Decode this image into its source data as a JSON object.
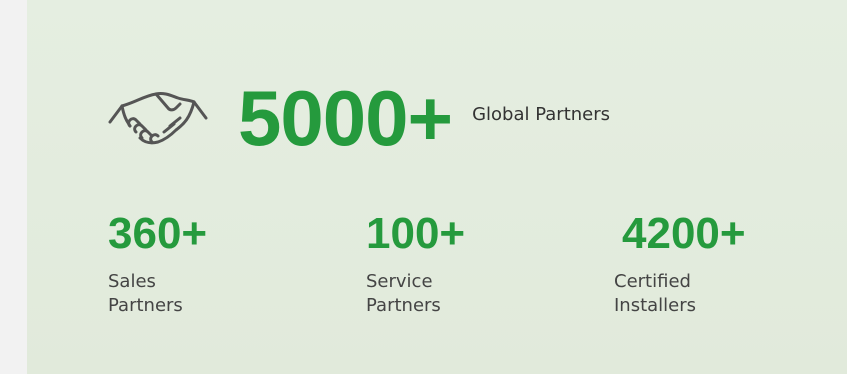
{
  "hero": {
    "value": "5000+",
    "label": "Global Partners",
    "icon": "handshake-icon"
  },
  "stats": [
    {
      "value": "360+",
      "label": "Sales\nPartners"
    },
    {
      "value": "100+",
      "label": "Service\nPartners"
    },
    {
      "value": "4200+",
      "label": "Certified\nInstallers"
    }
  ],
  "colors": {
    "accent": "#259a3d",
    "card_background": "#e3ecdf",
    "page_background": "#f2f2f2",
    "text": "#444444"
  }
}
